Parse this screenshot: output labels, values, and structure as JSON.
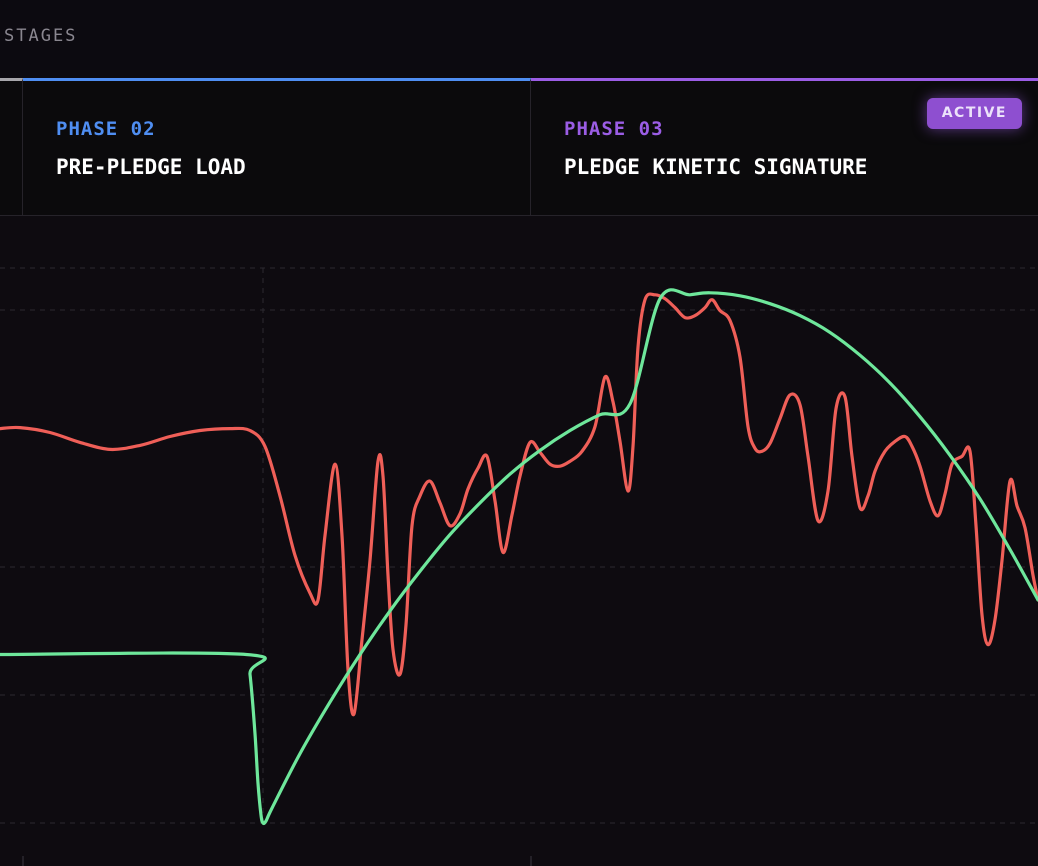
{
  "header": {
    "stages_label": "STAGES"
  },
  "phases": [
    {
      "number": "",
      "title": "",
      "color": "#a7a6ab"
    },
    {
      "number": "PHASE 02",
      "title": "PRE-PLEDGE LOAD",
      "color": "#4f8ef2"
    },
    {
      "number": "PHASE 03",
      "title": "PLEDGE KINETIC SIGNATURE",
      "color": "#9b5de5",
      "badge": "ACTIVE"
    }
  ],
  "colors": {
    "background": "#0e0b10",
    "grid": "#2c2930",
    "green_series": "#6ee79b",
    "red_series": "#ef5f58",
    "phase2_accent": "#4f8ef2",
    "phase3_accent": "#9b5de5"
  },
  "chart_data": {
    "type": "line",
    "title": "",
    "xlabel": "",
    "ylabel": "",
    "xlim": [
      0,
      1038
    ],
    "ylim": [
      0,
      560
    ],
    "grid": true,
    "legend": "none",
    "series": [
      {
        "color": "#6ee79b",
        "x": [
          0,
          246,
          250,
          255,
          258,
          261,
          263,
          266,
          272,
          300,
          330,
          360,
          390,
          420,
          450,
          480,
          510,
          540,
          570,
          600,
          630,
          660,
          690,
          710,
          740,
          770,
          800,
          830,
          860,
          890,
          920,
          950,
          980,
          1010,
          1038
        ],
        "y": [
          170,
          170,
          150,
          90,
          40,
          8,
          0,
          2,
          15,
          70,
          122,
          170,
          214,
          254,
          291,
          323,
          352,
          376,
          396,
          412,
          423,
          529,
          533,
          535,
          532,
          524,
          512,
          495,
          472,
          444,
          410,
          371,
          327,
          276,
          225
        ]
      },
      {
        "color": "#ef5f58",
        "x": [
          0,
          20,
          50,
          80,
          110,
          140,
          170,
          200,
          230,
          250,
          265,
          280,
          295,
          310,
          318,
          325,
          335,
          342,
          348,
          354,
          362,
          370,
          378,
          383,
          388,
          393,
          400,
          406,
          412,
          420,
          430,
          440,
          450,
          460,
          468,
          478,
          487,
          495,
          503,
          512,
          520,
          530,
          540,
          550,
          560,
          570,
          582,
          595,
          605,
          613,
          620,
          628,
          633,
          638,
          645,
          655,
          665,
          675,
          685,
          695,
          705,
          712,
          720,
          730,
          740,
          748,
          755,
          762,
          770,
          780,
          790,
          800,
          808,
          818,
          828,
          836,
          845,
          852,
          860,
          868,
          875,
          885,
          895,
          905,
          912,
          920,
          930,
          938,
          945,
          952,
          962,
          970,
          976,
          982,
          988,
          995,
          1002,
          1010,
          1017,
          1025,
          1033,
          1038
        ],
        "y": [
          398,
          399,
          394,
          384,
          377,
          381,
          390,
          396,
          398,
          396,
          380,
          330,
          270,
          232,
          225,
          290,
          362,
          290,
          155,
          110,
          185,
          265,
          365,
          350,
          250,
          175,
          150,
          200,
          300,
          330,
          345,
          323,
          300,
          312,
          337,
          358,
          370,
          325,
          273,
          311,
          350,
          384,
          374,
          362,
          360,
          365,
          375,
          400,
          450,
          425,
          385,
          335,
          380,
          480,
          528,
          533,
          529,
          520,
          510,
          512,
          520,
          528,
          517,
          507,
          470,
          400,
          378,
          375,
          383,
          408,
          432,
          422,
          370,
          305,
          335,
          418,
          430,
          370,
          318,
          330,
          355,
          375,
          385,
          390,
          380,
          360,
          325,
          310,
          332,
          362,
          370,
          375,
          300,
          210,
          180,
          205,
          265,
          345,
          320,
          298,
          250,
          225
        ]
      }
    ]
  }
}
